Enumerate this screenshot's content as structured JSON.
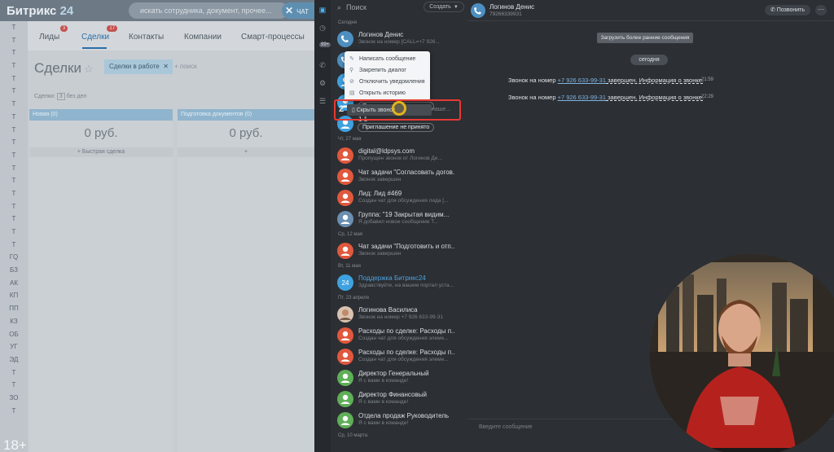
{
  "crm": {
    "logo_main": "Битрикс",
    "logo_num": "24",
    "search_placeholder": "искать сотрудника, документ, прочее...",
    "chat_button": "ЧАТ",
    "tabs": [
      {
        "label": "Лиды",
        "count": "3"
      },
      {
        "label": "Сделки",
        "count": "17"
      },
      {
        "label": "Контакты"
      },
      {
        "label": "Компании"
      },
      {
        "label": "Смарт-процессы"
      }
    ],
    "page_title": "Сделки",
    "filter_chip": "Сделки в работе",
    "filter_search": "+ поиск",
    "deals_line": {
      "label": "Сделки:",
      "count": "3",
      "suffix": "без дел"
    },
    "stages": [
      {
        "name": "Новая (0)",
        "amount": "0 руб.",
        "quick": "+ Быстрая сделка"
      },
      {
        "name": "Подготовка документов (0)",
        "amount": "0 руб.",
        "quick": "+"
      }
    ],
    "sidebar_labels": [
      "Т",
      "Т",
      "Т",
      "Т",
      "Т",
      "Т",
      "Т",
      "Т",
      "Т",
      "Т",
      "Т",
      "Т",
      "Т",
      "Т",
      "Т",
      "Т",
      "Т",
      "Т",
      "ГQ",
      "БЗ",
      "АК",
      "КП",
      "ПП",
      "КЗ",
      "ОБ",
      "УГ",
      "ЭД",
      "Т",
      "Т",
      "ЗО",
      "Т"
    ]
  },
  "overlay": "18+",
  "recents": {
    "search_placeholder": "Поиск",
    "create_label": "Создать",
    "groups": [
      {
        "header": "Сегодня",
        "items": [
          {
            "name": "Логинов Денис",
            "preview": "Звонок на номер [CALL=+7 926...",
            "color": "#4d8fc0",
            "kind": "phone"
          },
          {
            "name": "Логинов Денис",
            "preview": "+7926...",
            "color": "#4d8fc0",
            "kind": "phone"
          },
          {
            "name": "",
            "preview": "",
            "color": "#3fa2e0",
            "kind": "user"
          },
          {
            "name": "фамилия имя",
            "pill": "Приглашение не принято",
            "color": "#3fa2e0",
            "kind": "user"
          },
          {
            "name": "1 1",
            "pill": "Приглашение не принято",
            "color": "#3fa2e0",
            "kind": "user"
          }
        ]
      },
      {
        "header": "Чт, 27 мая",
        "items": [
          {
            "name": "digital@ldpsys.com",
            "preview": "Пропущен звонок от Логинов Де...",
            "color": "#e0583d",
            "kind": "user"
          },
          {
            "name": "Чат задачи \"Согласовать догов...",
            "preview": "Звонок завершен",
            "color": "#e0583d",
            "kind": "user"
          },
          {
            "name": "Лид: Лид #469",
            "preview": "Создан чат для обсуждения лида [...",
            "color": "#e0583d",
            "kind": "user"
          },
          {
            "name": "Группа: \"19 Закрытая видим...",
            "preview": "Я добавил новое сообщение Т...",
            "color": "#6a8fb0",
            "kind": "group"
          }
        ]
      },
      {
        "header": "Ср, 12 мая",
        "items": [
          {
            "name": "Чат задачи \"Подготовить и отп...",
            "preview": "Звонок завершен",
            "color": "#e0583d",
            "kind": "user"
          }
        ]
      },
      {
        "header": "Вт, 11 мая",
        "items": [
          {
            "name": "Поддержка Битрикс24",
            "preview": "Здравствуйте, на вашем портал уста...",
            "color": "#3fa2e0",
            "kind": "support"
          }
        ]
      },
      {
        "header": "Пт, 23 апреля",
        "items": [
          {
            "name": "Логинова Василиса",
            "preview": "Звонок на номер +7 926 633-99-31",
            "color": "#c08a6a",
            "kind": "photo"
          },
          {
            "name": "Расходы по сделке: Расходы п...",
            "preview": "Создан чат для обсуждения элеме...",
            "color": "#e0583d",
            "kind": "user"
          },
          {
            "name": "Расходы по сделке: Расходы п...",
            "preview": "Создан чат для обсуждения элеме...",
            "color": "#e0583d",
            "kind": "user"
          },
          {
            "name": "Директор Генеральный",
            "preview": "Я с вами в команде!",
            "color": "#5fae58",
            "kind": "user"
          },
          {
            "name": "Директор Финансовый",
            "preview": "Я с вами в команде!",
            "color": "#5fae58",
            "kind": "user"
          },
          {
            "name": "Отдела продаж Руководитель",
            "preview": "Я с вами в команде!",
            "color": "#5fae58",
            "kind": "user"
          }
        ]
      },
      {
        "header": "Ср, 10 марта",
        "items": []
      }
    ],
    "hidden_row_suffix": "наше...",
    "unread_count": "2"
  },
  "context_menu": {
    "items": [
      "Написать сообщение",
      "Закрепить диалог",
      "Отключить уведомления",
      "Открыть историю"
    ],
    "hide_call": "Скрыть звонок"
  },
  "chat": {
    "title": "Логинов Денис",
    "subtitle": "79266339931",
    "call_button": "Позвонить",
    "load_more": "Загрузить более ранние сообщения",
    "today": "сегодня",
    "messages": [
      {
        "prefix": "Звонок на номер ",
        "phone": "+7 926 633-99-31",
        "suffix": " завершен. Информация о звонке.",
        "time": "21:59"
      },
      {
        "prefix": "Звонок на номер ",
        "phone": "+7 926 633-99-31",
        "suffix": " завершен. Информация о звонке.",
        "time": "22:29"
      }
    ],
    "input_placeholder": "Введите сообщение"
  },
  "colors": {
    "accent": "#4cb0f0",
    "highlight": "#e53a35",
    "cursor": "#e3b21f"
  }
}
